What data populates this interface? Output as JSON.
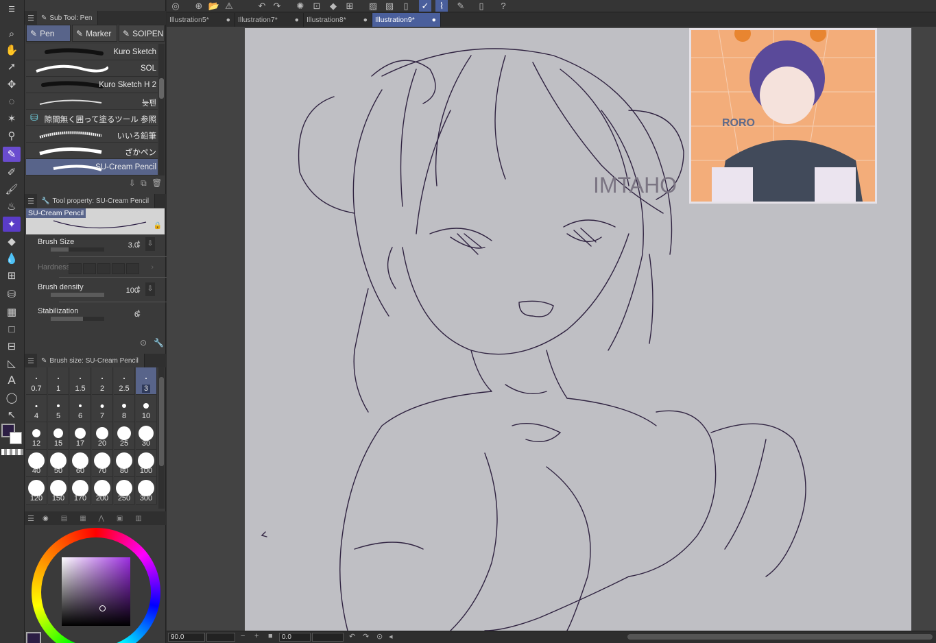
{
  "subtool_panel": {
    "tab_label": "Sub Tool: Pen",
    "groups": [
      {
        "label": "Pen",
        "icon": "pen-icon",
        "active": true
      },
      {
        "label": "Marker",
        "icon": "marker-icon",
        "active": false
      },
      {
        "label": "SOIPEN",
        "icon": "pen-icon",
        "active": false
      }
    ],
    "brushes": [
      {
        "name": "Kuro Sketch",
        "active": false
      },
      {
        "name": "SOL",
        "active": false
      },
      {
        "name": "Kuro Sketch H 2",
        "active": false
      },
      {
        "name": "늦펜",
        "active": false
      },
      {
        "name": "隙間無く囲って塗るツール 参照",
        "active": false
      },
      {
        "name": "いいろ鉛筆",
        "active": false
      },
      {
        "name": "ざかペン",
        "active": false
      },
      {
        "name": "SU-Cream Pencil",
        "active": true
      }
    ]
  },
  "tool_property": {
    "tab_label": "Tool property: SU-Cream Pencil",
    "preview_label": "SU-Cream Pencil",
    "brush_size": {
      "label": "Brush Size",
      "value": "3.0",
      "fraction": 0.33
    },
    "hardness": {
      "label": "Hardness"
    },
    "brush_density": {
      "label": "Brush density",
      "value": "100",
      "fraction": 1.0
    },
    "stabilization": {
      "label": "Stabilization",
      "value": "6",
      "fraction": 0.6
    }
  },
  "brush_size_panel": {
    "tab_label": "Brush size: SU-Cream Pencil",
    "sizes": [
      "0.7",
      "1",
      "1.5",
      "2",
      "2.5",
      "3",
      "4",
      "5",
      "6",
      "7",
      "8",
      "10",
      "12",
      "15",
      "17",
      "20",
      "25",
      "30",
      "40",
      "50",
      "60",
      "70",
      "80",
      "100",
      "120",
      "150",
      "170",
      "200",
      "250",
      "300"
    ],
    "active": "3"
  },
  "colors": {
    "main": "#2c1e44",
    "sub": "#ffffff",
    "accent": "#5a3cc8",
    "active_tab": "#4a5f9c",
    "sv_hue": "#9b2de0"
  },
  "document_tabs": [
    {
      "label": "Illustration5*",
      "active": false
    },
    {
      "label": "Illustration7*",
      "active": false
    },
    {
      "label": "Illustration8*",
      "active": false
    },
    {
      "label": "Illustration9*",
      "active": true
    }
  ],
  "canvas": {
    "watermark": "IMTAHO",
    "reference_text": "RORO"
  },
  "status": {
    "zoom": "90.0",
    "rotation": "0.0"
  }
}
